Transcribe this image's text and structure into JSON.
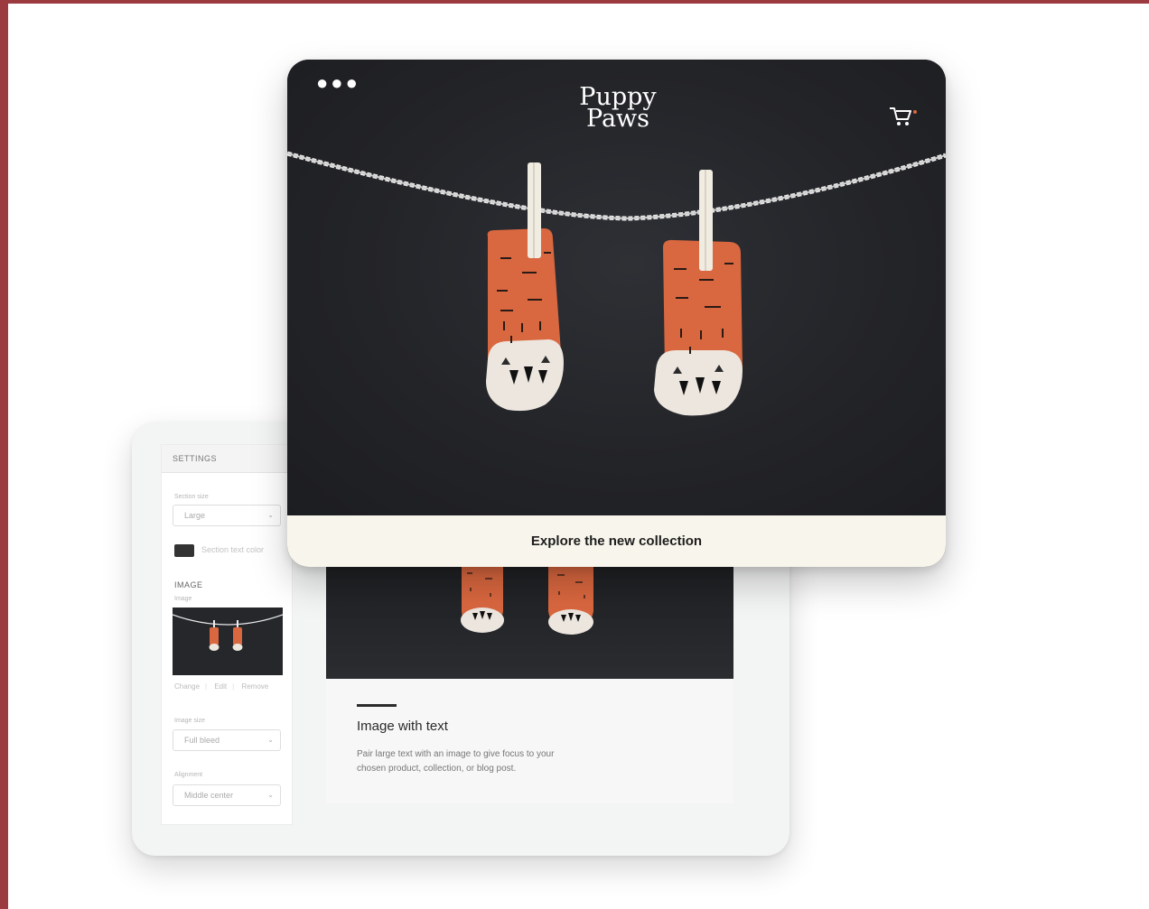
{
  "storefront": {
    "menu_icon": "more-dots-icon",
    "logo_line1": "Puppy",
    "logo_line2": "Paws",
    "cart_icon": "cart-icon",
    "caption": "Explore the new collection"
  },
  "editor": {
    "settings_title": "SETTINGS",
    "size_label": "Section size",
    "size_value": "Large",
    "color_label": "Section text color",
    "image_section_title": "IMAGE",
    "image_label": "Image",
    "image_actions": [
      "Change",
      "Edit",
      "Remove"
    ],
    "layout_label": "Image size",
    "layout_value": "Full bleed",
    "alignment_label": "Alignment",
    "alignment_value": "Middle center"
  },
  "preview": {
    "title": "Image with text",
    "body": "Pair large text with an image to give focus to your chosen product, collection, or blog post."
  },
  "colors": {
    "frame": "#9b3a3f",
    "hero_bg": "#26272b",
    "sock_orange": "#d9673f",
    "caption_bg": "#f8f6ec"
  }
}
